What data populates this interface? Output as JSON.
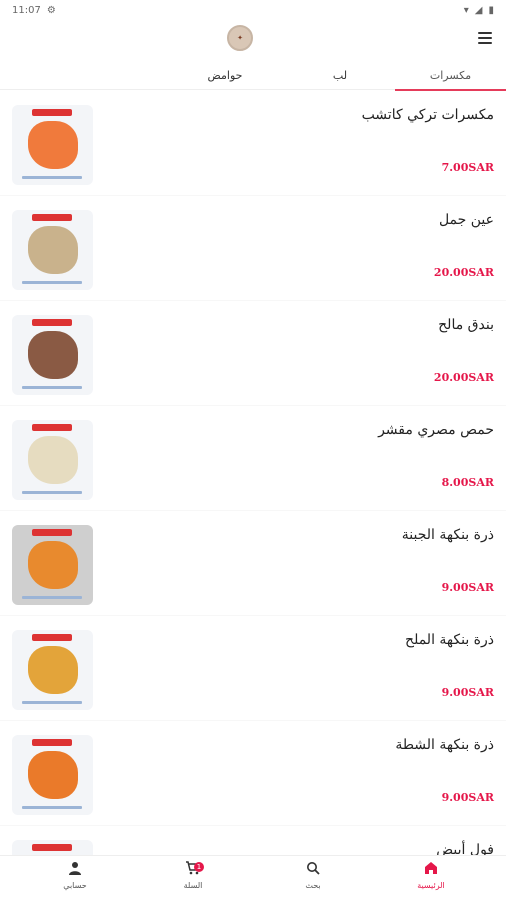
{
  "status_bar": {
    "time": "11:07"
  },
  "tabs": [
    {
      "label": "مكسرات",
      "active": true
    },
    {
      "label": "لب",
      "active": false
    },
    {
      "label": "حوامض",
      "active": false
    }
  ],
  "products": [
    {
      "name": "مكسرات تركي كاتشب",
      "price": "7.00SAR",
      "color": "#f07a3c"
    },
    {
      "name": "عين جمل",
      "price": "20.00SAR",
      "color": "#c9b28c"
    },
    {
      "name": "بندق مالح",
      "price": "20.00SAR",
      "color": "#8a5a44"
    },
    {
      "name": "حمص مصري مقشر",
      "price": "8.00SAR",
      "color": "#e6dcc0"
    },
    {
      "name": "ذرة بنكهة الجبنة",
      "price": "9.00SAR",
      "color": "#e88a2e"
    },
    {
      "name": "ذرة بنكهة الملح",
      "price": "9.00SAR",
      "color": "#e3a43a"
    },
    {
      "name": "ذرة بنكهة الشطة",
      "price": "9.00SAR",
      "color": "#ea7a2a"
    },
    {
      "name": "فول أبيض",
      "price": "",
      "color": "#e8e2d6"
    }
  ],
  "bottom_nav": [
    {
      "label": "حسابي",
      "icon": "person-icon"
    },
    {
      "label": "السلة",
      "icon": "cart-icon",
      "badge": "1"
    },
    {
      "label": "بحث",
      "icon": "search-icon"
    },
    {
      "label": "الرئيسية",
      "icon": "home-icon",
      "active": true
    }
  ],
  "colors": {
    "accent": "#e5174a"
  }
}
